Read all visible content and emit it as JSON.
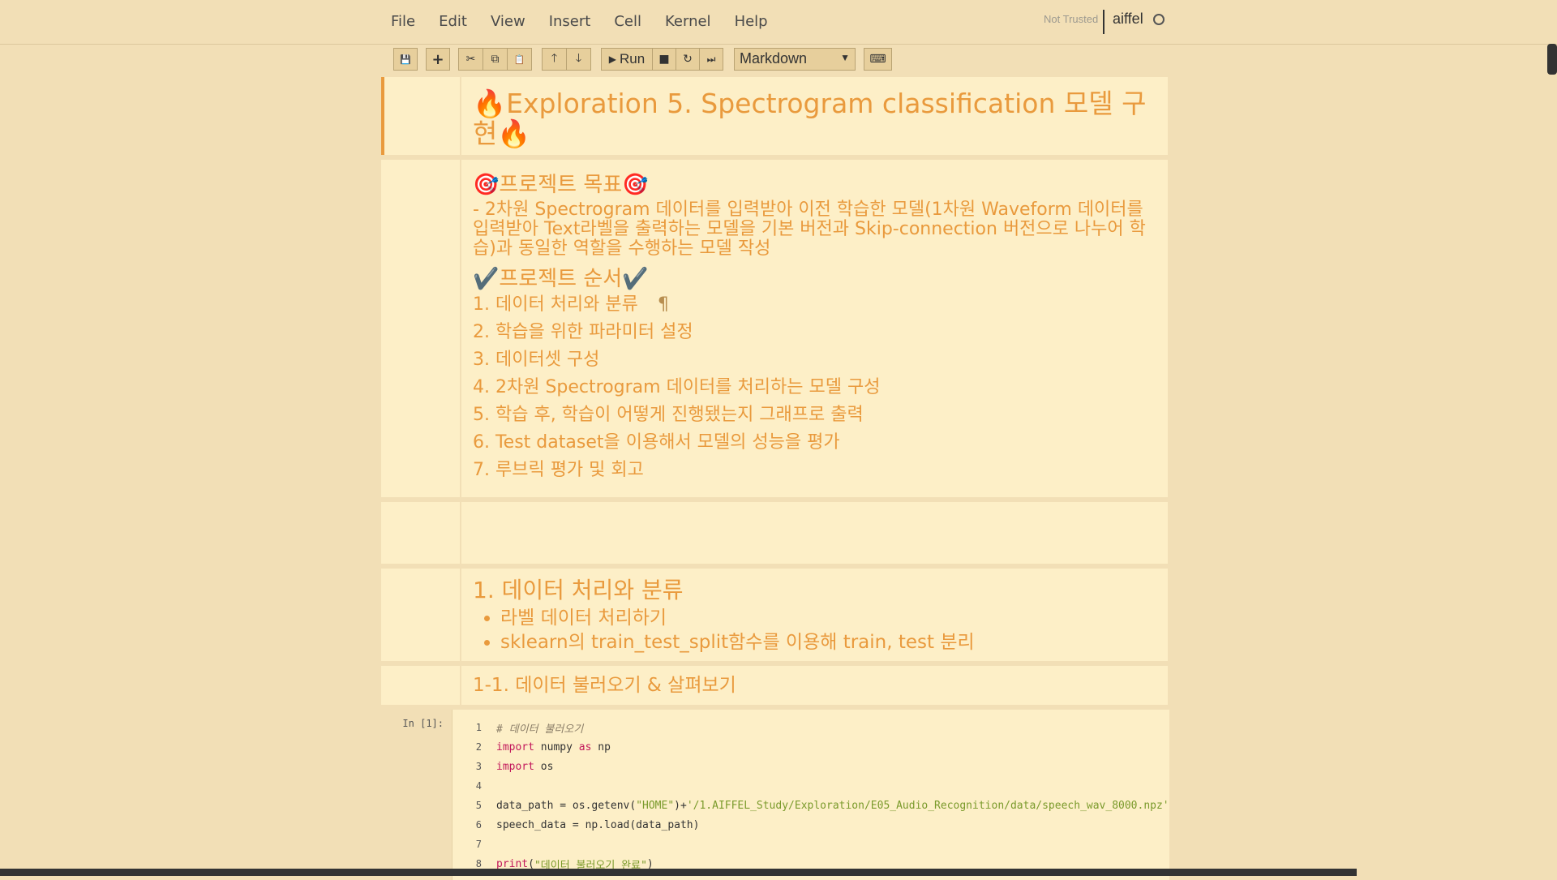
{
  "menu": [
    "File",
    "Edit",
    "View",
    "Insert",
    "Cell",
    "Kernel",
    "Help"
  ],
  "status": {
    "trust": "Not Trusted",
    "kernel": "aiffel"
  },
  "toolbar": {
    "run_label": "Run",
    "cell_type": "Markdown"
  },
  "icons": {
    "save": "💾",
    "add": "+",
    "cut": "✂",
    "copy": "⧉",
    "paste": "📋",
    "up": "🡑",
    "down": "🡓",
    "run": "▶",
    "stop": "■",
    "restart": "↻",
    "fast_forward": "⏭",
    "keyboard": "⌨"
  },
  "cells": {
    "title": "🔥Exploration 5. Spectrogram classification 모델 구현🔥",
    "goal_heading": "🎯프로젝트 목표🎯",
    "goal_text": "- 2차원 Spectrogram 데이터를 입력받아 이전 학습한 모델(1차원 Waveform 데이터를 입력받아 Text라벨을 출력하는 모델을 기본 버전과 Skip-connection 버전으로 나누어 학습)과 동일한 역할을 수행하는 모델 작성",
    "order_heading": "✔️프로젝트 순서✔️",
    "steps": [
      "1. 데이터 처리와 분류",
      "2. 학습을 위한 파라미터 설정",
      "3. 데이터셋 구성",
      "4. 2차원 Spectrogram 데이터를 처리하는 모델 구성",
      "5. 학습 후, 학습이 어떻게 진행됐는지 그래프로 출력",
      "6. Test dataset을 이용해서 모델의 성능을 평가",
      "7. 루브릭 평가 및 회고"
    ],
    "pilcrow": "¶",
    "section1_heading": "1. 데이터 처리와 분류",
    "section1_bullets": [
      "라벨 데이터 처리하기",
      "sklearn의 train_test_split함수를 이용해 train, test 분리"
    ],
    "subsection_heading": "1-1. 데이터 불러오기 & 살펴보기"
  },
  "code_cell": {
    "prompt": "In [1]:",
    "lines": [
      {
        "n": "1",
        "parts": [
          {
            "t": "cm",
            "v": "# 데이터 불러오기"
          }
        ]
      },
      {
        "n": "2",
        "parts": [
          {
            "t": "kw",
            "v": "import"
          },
          {
            "t": "tx",
            "v": " numpy "
          },
          {
            "t": "kw",
            "v": "as"
          },
          {
            "t": "tx",
            "v": " np"
          }
        ]
      },
      {
        "n": "3",
        "parts": [
          {
            "t": "kw",
            "v": "import"
          },
          {
            "t": "tx",
            "v": " os"
          }
        ]
      },
      {
        "n": "4",
        "parts": []
      },
      {
        "n": "5",
        "parts": [
          {
            "t": "tx",
            "v": "data_path = os.getenv("
          },
          {
            "t": "st",
            "v": "\"HOME\""
          },
          {
            "t": "tx",
            "v": ")+"
          },
          {
            "t": "st",
            "v": "'/1.AIFFEL_Study/Exploration/E05_Audio_Recognition/data/speech_wav_8000.npz'"
          }
        ]
      },
      {
        "n": "6",
        "parts": [
          {
            "t": "tx",
            "v": "speech_data = np.load(data_path)"
          }
        ]
      },
      {
        "n": "7",
        "parts": []
      },
      {
        "n": "8",
        "parts": [
          {
            "t": "kw",
            "v": "print"
          },
          {
            "t": "tx",
            "v": "("
          },
          {
            "t": "st",
            "v": "\"데이터 불러오기 완료\""
          },
          {
            "t": "tx",
            "v": ")"
          }
        ]
      }
    ]
  }
}
